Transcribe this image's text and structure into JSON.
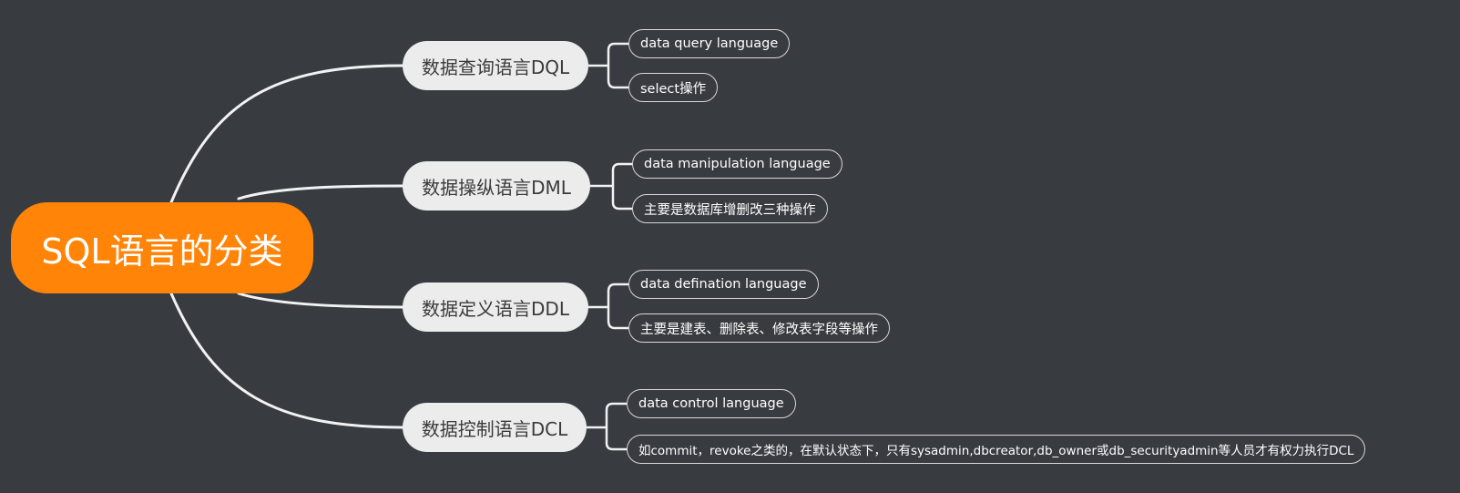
{
  "root": {
    "label": "SQL语言的分类"
  },
  "branches": [
    {
      "label": "数据查询语言DQL",
      "leaves": [
        "data query language",
        "select操作"
      ]
    },
    {
      "label": "数据操纵语言DML",
      "leaves": [
        "data manipulation language",
        "主要是数据库增删改三种操作"
      ]
    },
    {
      "label": "数据定义语言DDL",
      "leaves": [
        "data defination language",
        "主要是建表、删除表、修改表字段等操作"
      ]
    },
    {
      "label": "数据控制语言DCL",
      "leaves": [
        "data control language",
        "如commit，revoke之类的，在默认状态下，只有sysadmin,dbcreator,db_owner或db_securityadmin等人员才有权力执行DCL"
      ]
    }
  ],
  "colors": {
    "background": "#383b40",
    "root": "#ff8407",
    "branch": "#ececec",
    "connector": "#f2f2f2"
  }
}
